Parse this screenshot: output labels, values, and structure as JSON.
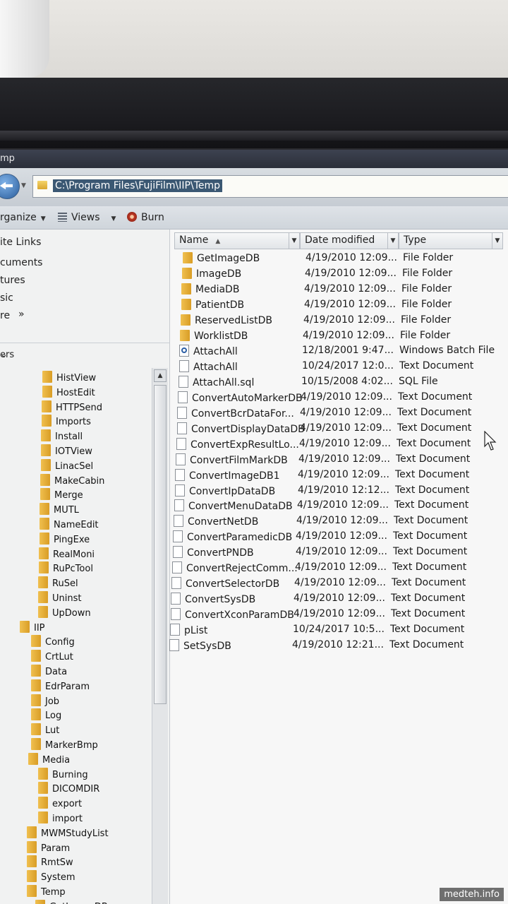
{
  "window": {
    "title": "mp"
  },
  "address": {
    "path": "C:\\Program Files\\FujiFilm\\IIP\\Temp"
  },
  "toolbar": {
    "organize": "rganize",
    "views": "Views",
    "burn": "Burn"
  },
  "favorites": [
    "ite Links",
    "cuments",
    "tures",
    "sic",
    "re"
  ],
  "favorites_more": "»",
  "folders_label": "ers",
  "tree": [
    "HistView",
    "HostEdit",
    "HTTPSend",
    "Imports",
    "Install",
    "IOTView",
    "LinacSel",
    "MakeCabin",
    "Merge",
    "MUTL",
    "NameEdit",
    "PingExe",
    "RealMoni",
    "RuPcTool",
    "RuSel",
    "Uninst",
    "UpDown",
    "IIP",
    "Config",
    "CrtLut",
    "Data",
    "EdrParam",
    "Job",
    "Log",
    "Lut",
    "MarkerBmp",
    "Media",
    "Burning",
    "DICOMDIR",
    "export",
    "import",
    "MWMStudyList",
    "Param",
    "RmtSw",
    "System",
    "Temp",
    "GetImageDB"
  ],
  "columns": {
    "name": "Name",
    "date": "Date modified",
    "type": "Type"
  },
  "files": [
    {
      "name": "GetImageDB",
      "date": "4/19/2010 12:09...",
      "type": "File Folder",
      "icon": "folder"
    },
    {
      "name": "ImageDB",
      "date": "4/19/2010 12:09...",
      "type": "File Folder",
      "icon": "folder"
    },
    {
      "name": "MediaDB",
      "date": "4/19/2010 12:09...",
      "type": "File Folder",
      "icon": "folder"
    },
    {
      "name": "PatientDB",
      "date": "4/19/2010 12:09...",
      "type": "File Folder",
      "icon": "folder"
    },
    {
      "name": "ReservedListDB",
      "date": "4/19/2010 12:09...",
      "type": "File Folder",
      "icon": "folder"
    },
    {
      "name": "WorklistDB",
      "date": "4/19/2010 12:09...",
      "type": "File Folder",
      "icon": "folder"
    },
    {
      "name": "AttachAll",
      "date": "12/18/2001 9:47...",
      "type": "Windows Batch File",
      "icon": "bat"
    },
    {
      "name": "AttachAll",
      "date": "10/24/2017 12:0...",
      "type": "Text Document",
      "icon": "doc"
    },
    {
      "name": "AttachAll.sql",
      "date": "10/15/2008 4:02...",
      "type": "SQL File",
      "icon": "doc"
    },
    {
      "name": "ConvertAutoMarkerDB",
      "date": "4/19/2010 12:09...",
      "type": "Text Document",
      "icon": "doc"
    },
    {
      "name": "ConvertBcrDataFor...",
      "date": "4/19/2010 12:09...",
      "type": "Text Document",
      "icon": "doc"
    },
    {
      "name": "ConvertDisplayDataDB",
      "date": "4/19/2010 12:09...",
      "type": "Text Document",
      "icon": "doc"
    },
    {
      "name": "ConvertExpResultLo...",
      "date": "4/19/2010 12:09...",
      "type": "Text Document",
      "icon": "doc"
    },
    {
      "name": "ConvertFilmMarkDB",
      "date": "4/19/2010 12:09...",
      "type": "Text Document",
      "icon": "doc"
    },
    {
      "name": "ConvertImageDB1",
      "date": "4/19/2010 12:09...",
      "type": "Text Document",
      "icon": "doc"
    },
    {
      "name": "ConvertIpDataDB",
      "date": "4/19/2010 12:12...",
      "type": "Text Document",
      "icon": "doc"
    },
    {
      "name": "ConvertMenuDataDB",
      "date": "4/19/2010 12:09...",
      "type": "Text Document",
      "icon": "doc"
    },
    {
      "name": "ConvertNetDB",
      "date": "4/19/2010 12:09...",
      "type": "Text Document",
      "icon": "doc"
    },
    {
      "name": "ConvertParamedicDB",
      "date": "4/19/2010 12:09...",
      "type": "Text Document",
      "icon": "doc"
    },
    {
      "name": "ConvertPNDB",
      "date": "4/19/2010 12:09...",
      "type": "Text Document",
      "icon": "doc"
    },
    {
      "name": "ConvertRejectComm...",
      "date": "4/19/2010 12:09...",
      "type": "Text Document",
      "icon": "doc"
    },
    {
      "name": "ConvertSelectorDB",
      "date": "4/19/2010 12:09...",
      "type": "Text Document",
      "icon": "doc"
    },
    {
      "name": "ConvertSysDB",
      "date": "4/19/2010 12:09...",
      "type": "Text Document",
      "icon": "doc"
    },
    {
      "name": "ConvertXconParamDB",
      "date": "4/19/2010 12:09...",
      "type": "Text Document",
      "icon": "doc"
    },
    {
      "name": "pList",
      "date": "10/24/2017 10:5...",
      "type": "Text Document",
      "icon": "doc"
    },
    {
      "name": "SetSysDB",
      "date": "4/19/2010 12:21...",
      "type": "Text Document",
      "icon": "doc"
    }
  ],
  "watermark": "medteh.info"
}
